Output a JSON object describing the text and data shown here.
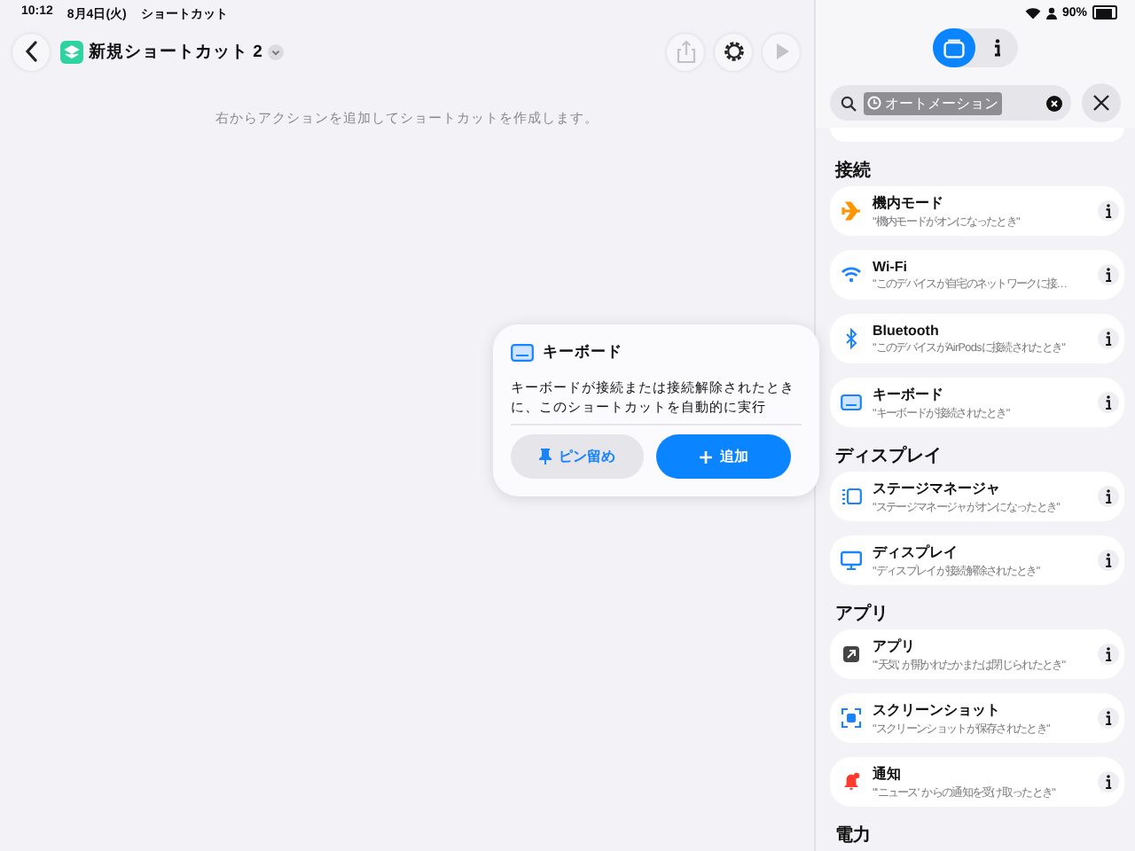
{
  "status_bar": {
    "time": "10:12",
    "date": "8月4日(火)",
    "app": "ショートカット",
    "battery": "90%"
  },
  "toolbar": {
    "title": "新規ショートカット 2",
    "buttons": [
      {
        "kind": "share",
        "disabled": true
      },
      {
        "kind": "settings",
        "disabled": false
      },
      {
        "kind": "play",
        "disabled": true
      }
    ]
  },
  "editor": {
    "hint": "右からアクションを追加してショートカットを作成します。"
  },
  "popup": {
    "title": "キーボード",
    "description": "キーボードが接続または接続解除されたときに、このショートカットを自動的に実行",
    "buttons": [
      {
        "label": "ピン留め",
        "kind": "pin"
      },
      {
        "label": "追加",
        "kind": "add"
      }
    ]
  },
  "panel": {
    "segments": [
      {
        "kind": "actions",
        "selected": true
      },
      {
        "kind": "info",
        "selected": false
      }
    ],
    "search": {
      "value": "オートメーション"
    },
    "sections": [
      {
        "title": "接続",
        "items": [
          {
            "kind": "airplane",
            "title": "機内モード",
            "subtitle": "\"機内モードがオンになったとき\""
          },
          {
            "kind": "wifi",
            "title": "Wi-Fi",
            "subtitle": "\"このデバイスが自宅のネットワークに接…"
          },
          {
            "kind": "bluetooth",
            "title": "Bluetooth",
            "subtitle": "\"このデバイスがAirPodsに接続されたとき\""
          },
          {
            "kind": "keyboard",
            "title": "キーボード",
            "subtitle": "\"キーボードが接続されたとき\""
          }
        ]
      },
      {
        "title": "ディスプレイ",
        "items": [
          {
            "kind": "stage",
            "title": "ステージマネージャ",
            "subtitle": "\"ステージマネージャがオンになったとき\""
          },
          {
            "kind": "display",
            "title": "ディスプレイ",
            "subtitle": "\"ディスプレイが接続解除されたとき\""
          }
        ]
      },
      {
        "title": "アプリ",
        "items": [
          {
            "kind": "app",
            "title": "アプリ",
            "subtitle": "\"'天気' が開かれたかまたは閉じられたとき\""
          },
          {
            "kind": "screenshot",
            "title": "スクリーンショット",
            "subtitle": "\"スクリーンショットが保存されたとき\""
          },
          {
            "kind": "notification",
            "title": "通知",
            "subtitle": "\"'ニュース' からの通知を受け取ったとき\""
          }
        ]
      },
      {
        "title": "電力"
      }
    ]
  }
}
